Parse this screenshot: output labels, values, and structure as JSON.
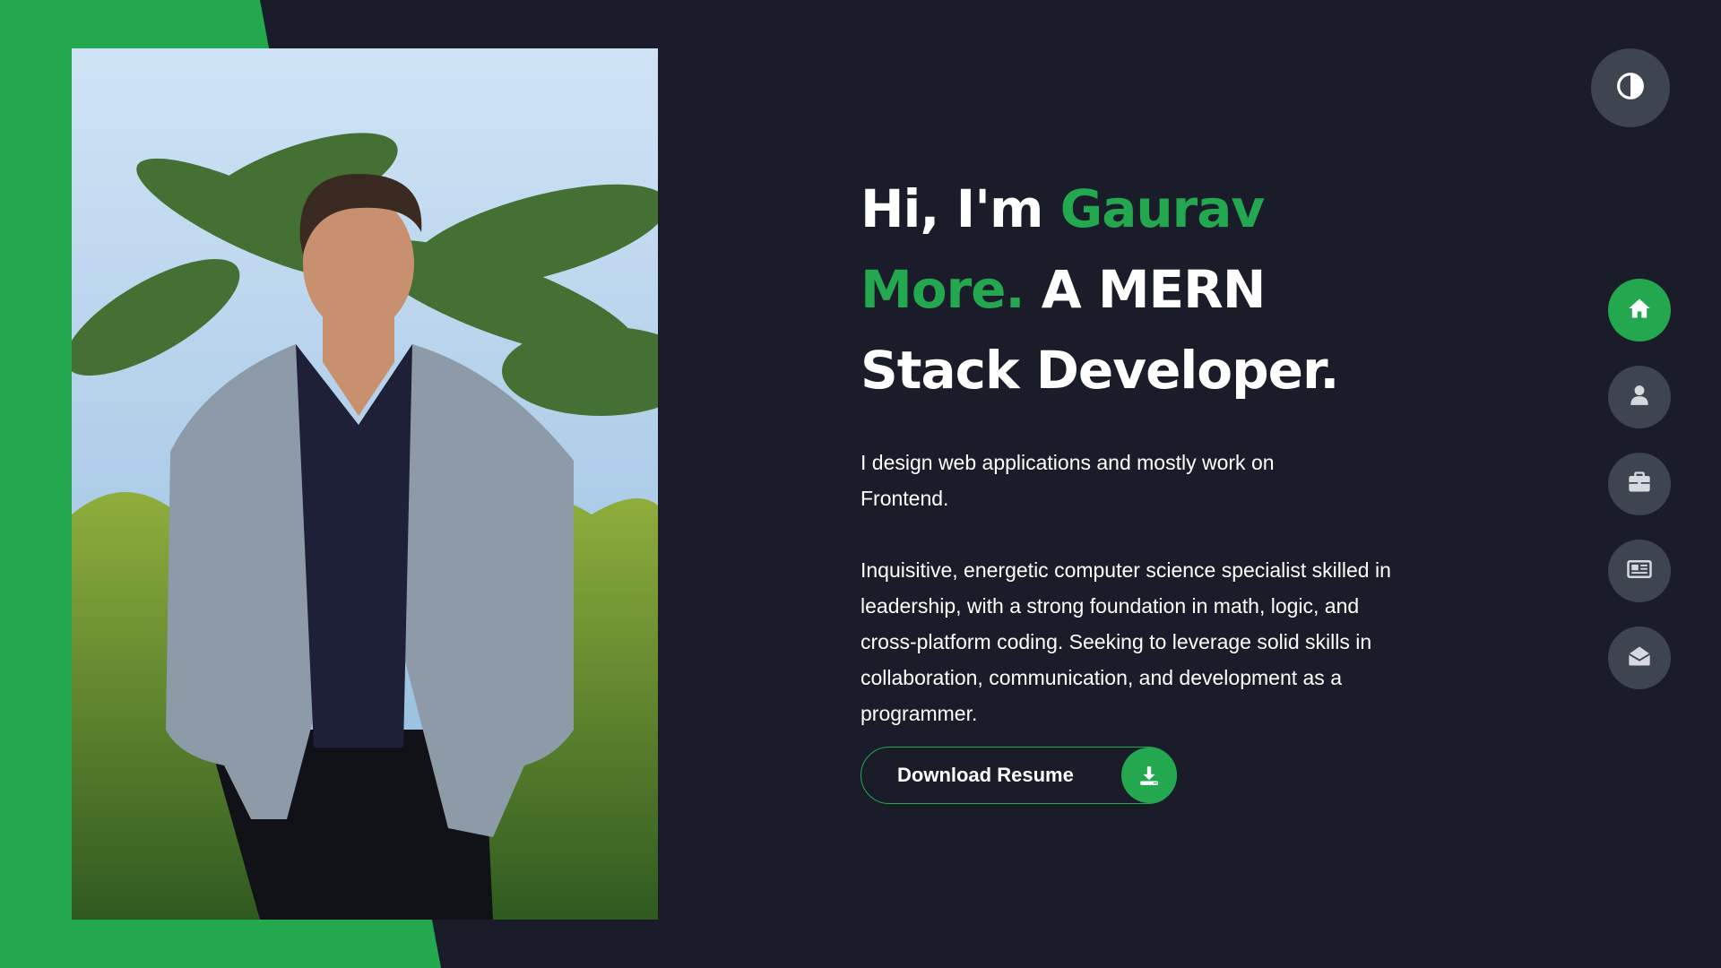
{
  "hero": {
    "greeting": "Hi, I'm ",
    "name_first": "Gaurav",
    "name_last": "More.",
    "role_line1": " A MERN",
    "role_line2": "Stack Developer.",
    "intro": "I design web applications and mostly work on Frontend.",
    "bio": "Inquisitive, energetic computer science specialist skilled in leadership, with a strong foundation in math, logic, and cross-platform coding. Seeking to leverage solid skills in collaboration, communication, and development as a programmer.",
    "download_label": "Download Resume"
  },
  "colors": {
    "accent": "#24a84f",
    "background": "#1a1c29",
    "nav_button": "#3f4451"
  },
  "theme_toggle": {
    "icon": "contrast-icon"
  },
  "side_nav": {
    "items": [
      {
        "icon": "home-icon",
        "active": true
      },
      {
        "icon": "user-icon",
        "active": false
      },
      {
        "icon": "briefcase-icon",
        "active": false
      },
      {
        "icon": "portfolio-icon",
        "active": false
      },
      {
        "icon": "mail-icon",
        "active": false
      }
    ]
  }
}
